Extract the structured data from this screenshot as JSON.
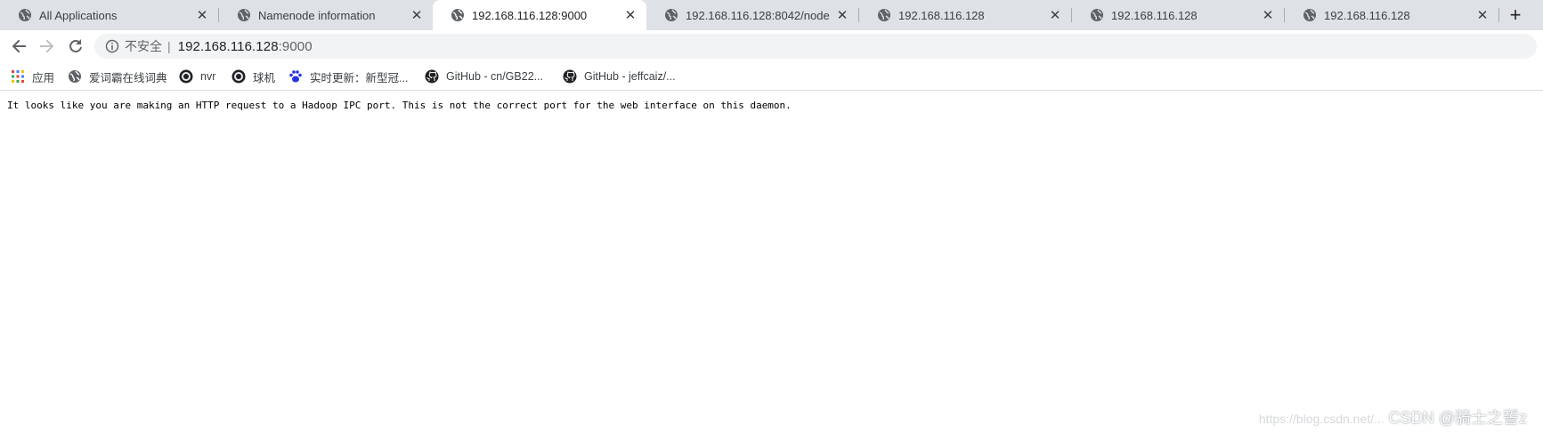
{
  "tabs": [
    {
      "title": "All Applications",
      "active": false
    },
    {
      "title": "Namenode information",
      "active": false
    },
    {
      "title": "192.168.116.128:9000",
      "active": true
    },
    {
      "title": "192.168.116.128:8042/node",
      "active": false
    },
    {
      "title": "192.168.116.128",
      "active": false
    },
    {
      "title": "192.168.116.128",
      "active": false
    },
    {
      "title": "192.168.116.128",
      "active": false
    }
  ],
  "toolbar": {
    "security_label": "不安全",
    "divider": "|",
    "url_host": "192.168.116.128",
    "url_port": ":9000"
  },
  "bookmarks": [
    {
      "label": "应用",
      "icon": "apps-grid-icon"
    },
    {
      "label": "爱词霸在线词典",
      "icon": "globe-icon"
    },
    {
      "label": "nvr",
      "icon": "camera-icon"
    },
    {
      "label": "球机",
      "icon": "camera-icon"
    },
    {
      "label": "实时更新：新型冠...",
      "icon": "baidu-paw-icon"
    },
    {
      "label": "GitHub - cn/GB22...",
      "icon": "github-icon"
    },
    {
      "label": "GitHub - jeffcaiz/...",
      "icon": "github-icon"
    }
  ],
  "page": {
    "message": "It looks like you are making an HTTP request to a Hadoop IPC port. This is not the correct port for the web interface on this daemon."
  },
  "watermark": {
    "faint": "https://blog.csdn.net/...",
    "text": "CSDN @骑士之誓z"
  },
  "colors": {
    "tabstrip_bg": "#dee1e6",
    "omnibox_bg": "#f1f3f4",
    "icon_gray": "#5f6368"
  }
}
